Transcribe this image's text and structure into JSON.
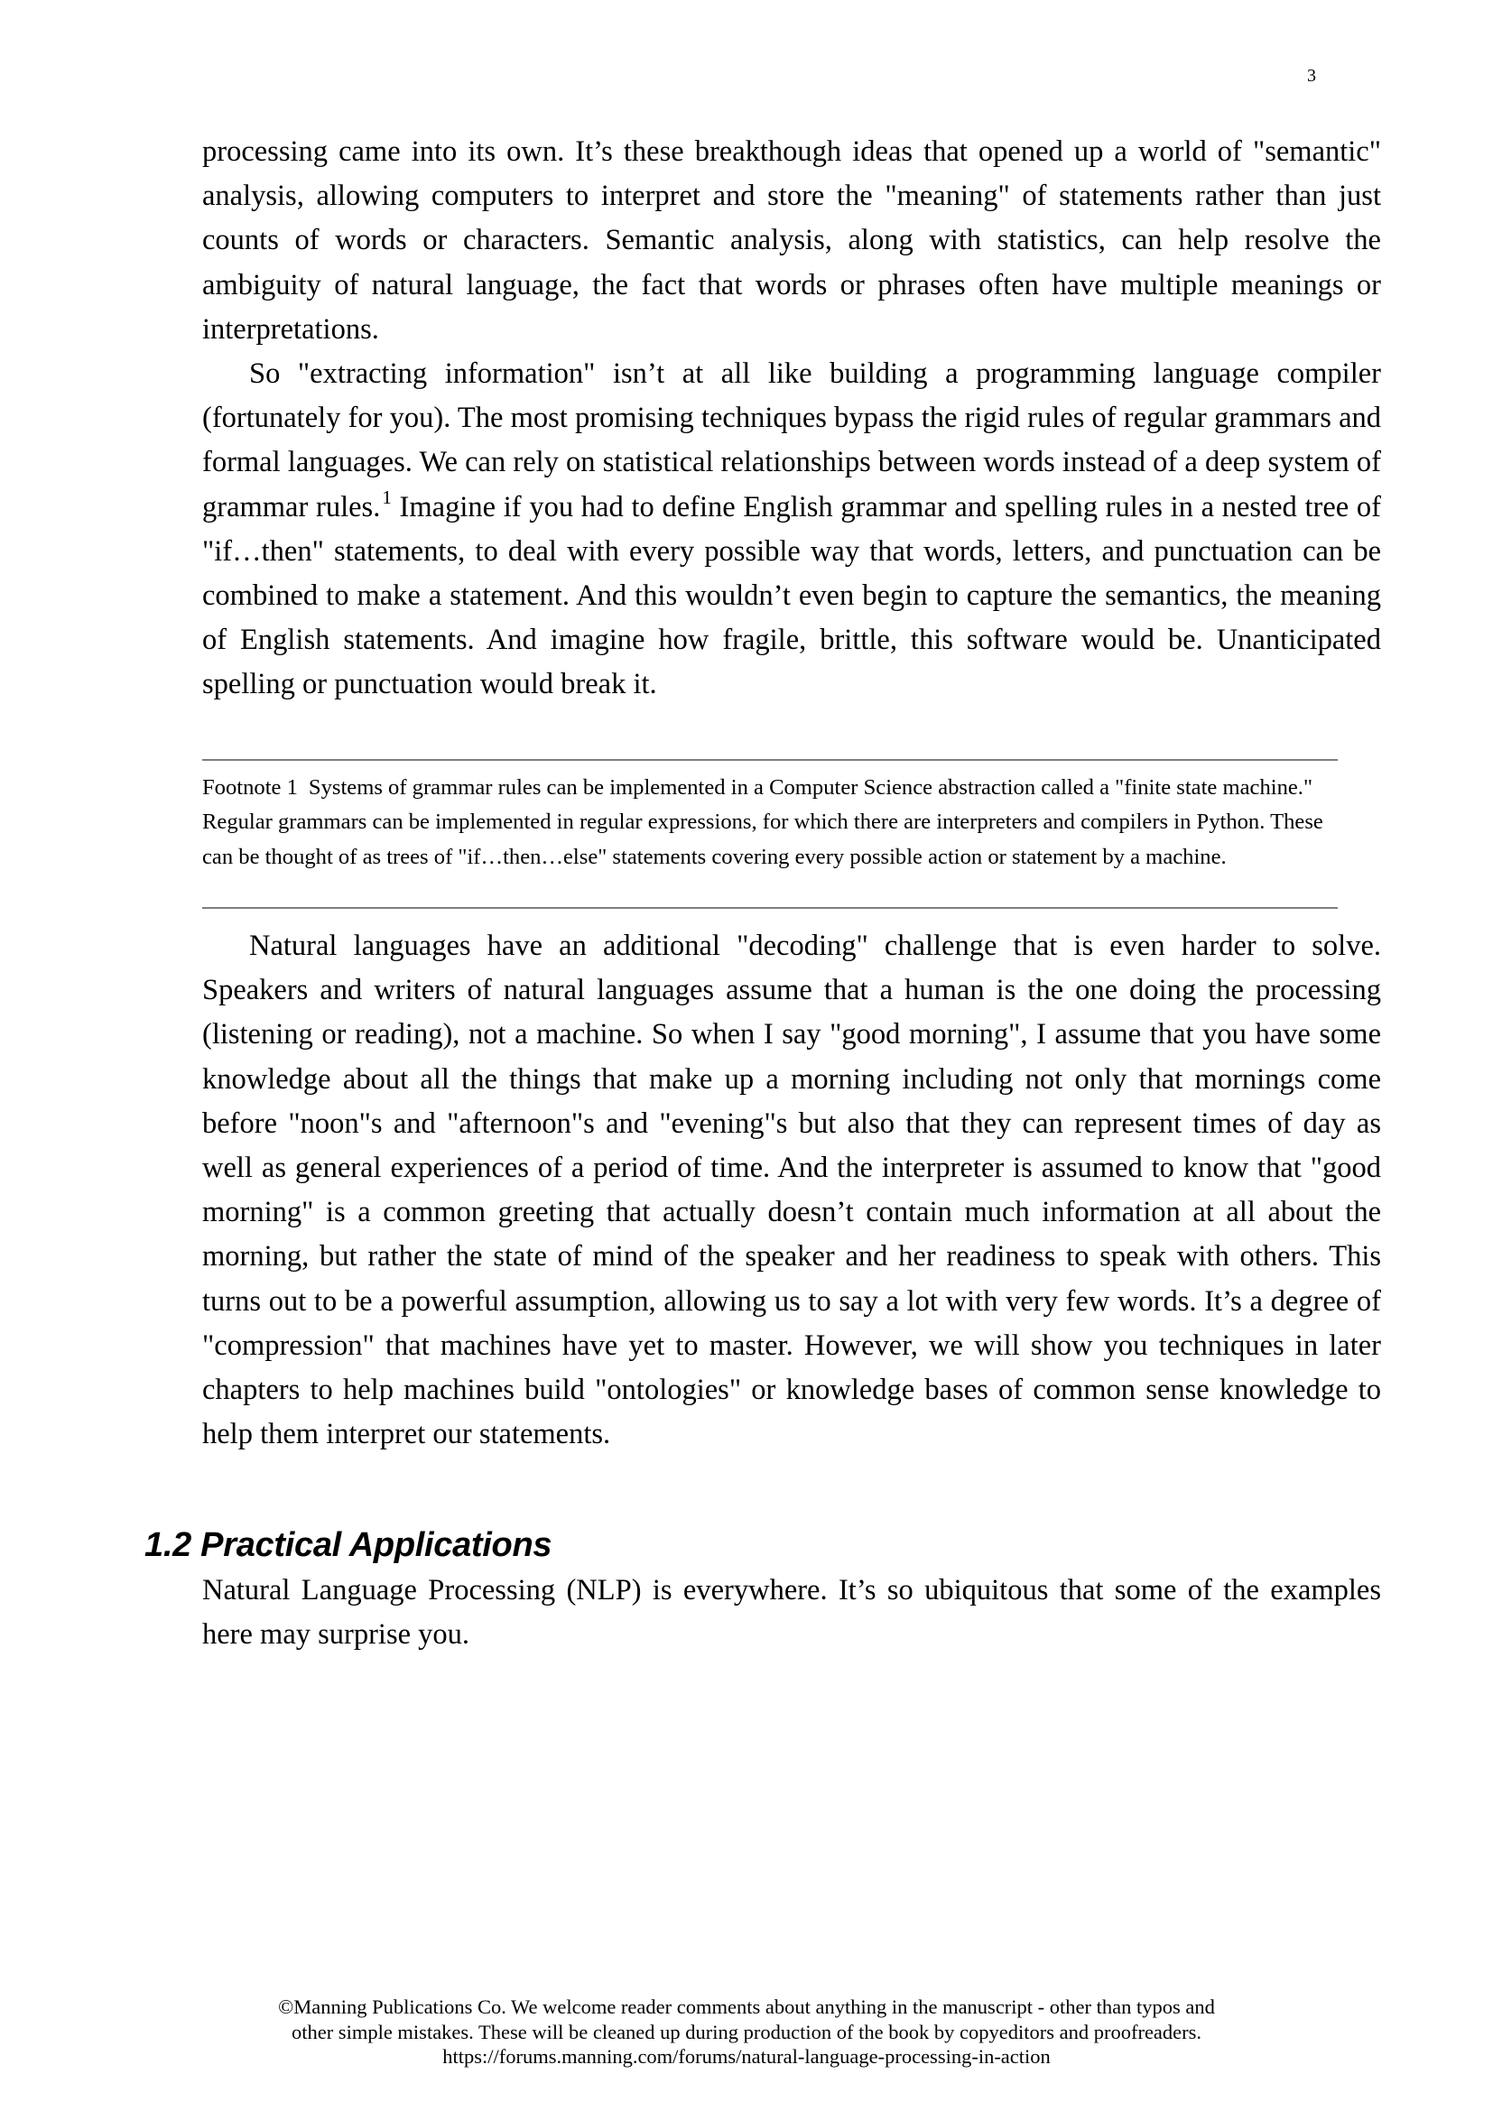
{
  "page": {
    "number": "3"
  },
  "paragraphs_block1": [
    {
      "indent": false,
      "text": "processing came into its own. It’s these breakthough ideas that opened up a world of \"semantic\" analysis, allowing computers to interpret and store the \"meaning\" of statements rather than just counts of words or characters. Semantic analysis, along with statistics, can help resolve the ambiguity of natural language, the fact that words or phrases often have multiple meanings or interpretations."
    },
    {
      "indent": true,
      "text_before_ref": "So \"extracting information\" isn’t at all like building a programming language compiler (fortunately for you). The most promising techniques bypass the rigid rules of regular grammars and formal languages. We can rely on statistical relationships between words instead of a deep system of grammar rules.",
      "footnote_ref": "1",
      "text_after_ref": " Imagine if you had to define English grammar and spelling rules in a nested tree of \"if…then\" statements, to deal with every possible way that words, letters, and punctuation can be combined to make a statement. And this wouldn’t even begin to capture the semantics, the meaning of English statements. And imagine how fragile, brittle, this software would be. Unanticipated spelling or punctuation would break it."
    }
  ],
  "footnote": {
    "label": "Footnote 1",
    "text": "Systems of grammar rules can be implemented in a Computer Science abstraction called a \"finite state machine.\" Regular grammars can be implemented in regular expressions, for which there are interpreters and compilers in Python. These can be thought of as trees of \"if…then…else\" statements covering every possible action or statement by a machine."
  },
  "paragraphs_block2": [
    {
      "indent": true,
      "text": "Natural languages have an additional \"decoding\" challenge that is even harder to solve. Speakers and writers of natural languages assume that a human is the one doing the processing (listening or reading), not a machine. So when I say \"good morning\", I assume that you have some knowledge about all the things that make up a morning including not only that mornings come before \"noon\"s and \"afternoon\"s and \"evening\"s but also that they can represent times of day as well as general experiences of a period of time. And the interpreter is assumed to know that \"good morning\" is a common greeting that actually doesn’t contain much information at all about the morning, but rather the state of mind of the speaker and her readiness to speak with others. This turns out to be a powerful assumption, allowing us to say a lot with very few words. It’s a degree of \"compression\" that machines have yet to master. However, we will show you techniques in later chapters to help machines build \"ontologies\" or knowledge bases of common sense knowledge to help them interpret our statements."
    }
  ],
  "section": {
    "heading": "1.2 Practical Applications",
    "paragraphs": [
      {
        "indent": false,
        "text": "Natural Language Processing (NLP) is everywhere. It’s so ubiquitous that some of the examples here may surprise you."
      }
    ]
  },
  "footer": {
    "line1": "©Manning Publications Co. We welcome reader comments about anything in the manuscript - other than typos and",
    "line2": "other simple mistakes. These will be cleaned up during production of the book by copyeditors and proofreaders.",
    "line3": "https://forums.manning.com/forums/natural-language-processing-in-action"
  }
}
